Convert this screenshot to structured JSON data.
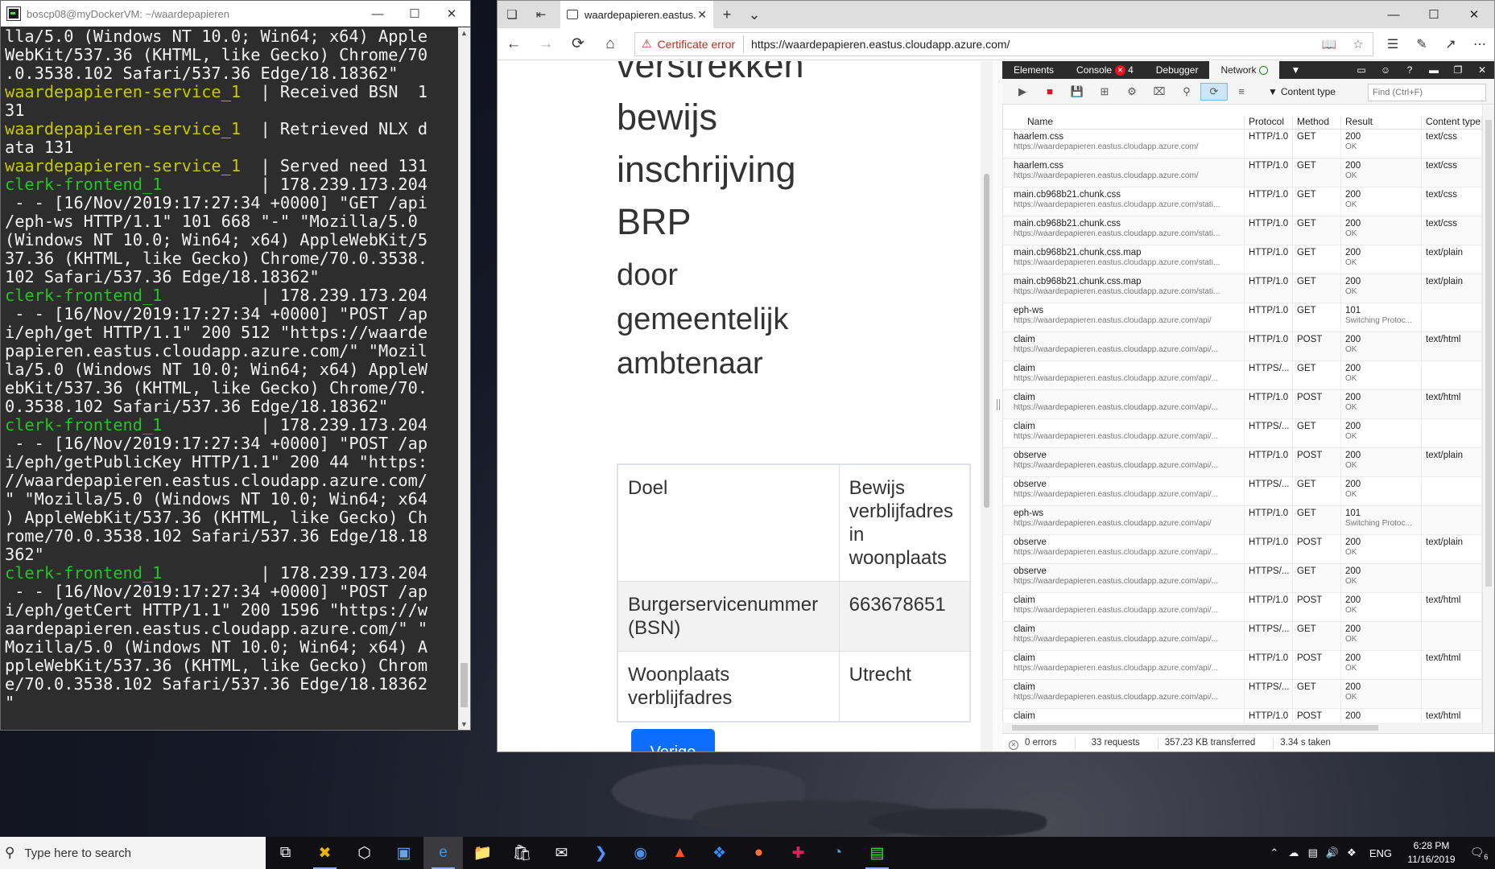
{
  "terminal": {
    "title": "boscp08@myDockerVM: ~/waardepapieren",
    "lines": [
      {
        "text": "lla/5.0 (Windows NT 10.0; Win64; x64) Apple"
      },
      {
        "text": "WebKit/537.36 (KHTML, like Gecko) Chrome/70"
      },
      {
        "text": ".0.3538.102 Safari/537.36 Edge/18.18362\""
      },
      {
        "prefix": "waardepapieren-service_1",
        "text": "  | Received BSN  1"
      },
      {
        "text": "31"
      },
      {
        "prefix": "waardepapieren-service_1",
        "text": "  | Retrieved NLX d"
      },
      {
        "text": "ata 131"
      },
      {
        "prefix": "waardepapieren-service_1",
        "text": "  | Served need 131"
      },
      {
        "prefix2": "clerk-frontend_1",
        "text": "          | 178.239.173.204"
      },
      {
        "text": " - - [16/Nov/2019:17:27:34 +0000] \"GET /api"
      },
      {
        "text": "/eph-ws HTTP/1.1\" 101 668 \"-\" \"Mozilla/5.0 "
      },
      {
        "text": "(Windows NT 10.0; Win64; x64) AppleWebKit/5"
      },
      {
        "text": "37.36 (KHTML, like Gecko) Chrome/70.0.3538."
      },
      {
        "text": "102 Safari/537.36 Edge/18.18362\""
      },
      {
        "prefix2": "clerk-frontend_1",
        "text": "          | 178.239.173.204"
      },
      {
        "text": " - - [16/Nov/2019:17:27:34 +0000] \"POST /ap"
      },
      {
        "text": "i/eph/get HTTP/1.1\" 200 512 \"https://waarde"
      },
      {
        "text": "papieren.eastus.cloudapp.azure.com/\" \"Mozil"
      },
      {
        "text": "la/5.0 (Windows NT 10.0; Win64; x64) AppleW"
      },
      {
        "text": "ebKit/537.36 (KHTML, like Gecko) Chrome/70."
      },
      {
        "text": "0.3538.102 Safari/537.36 Edge/18.18362\""
      },
      {
        "prefix2": "clerk-frontend_1",
        "text": "          | 178.239.173.204"
      },
      {
        "text": " - - [16/Nov/2019:17:27:34 +0000] \"POST /ap"
      },
      {
        "text": "i/eph/getPublicKey HTTP/1.1\" 200 44 \"https:"
      },
      {
        "text": "//waardepapieren.eastus.cloudapp.azure.com/"
      },
      {
        "text": "\" \"Mozilla/5.0 (Windows NT 10.0; Win64; x64"
      },
      {
        "text": ") AppleWebKit/537.36 (KHTML, like Gecko) Ch"
      },
      {
        "text": "rome/70.0.3538.102 Safari/537.36 Edge/18.18"
      },
      {
        "text": "362\""
      },
      {
        "prefix2": "clerk-frontend_1",
        "text": "          | 178.239.173.204"
      },
      {
        "text": " - - [16/Nov/2019:17:27:34 +0000] \"POST /ap"
      },
      {
        "text": "i/eph/getCert HTTP/1.1\" 200 1596 \"https://w"
      },
      {
        "text": "aardepapieren.eastus.cloudapp.azure.com/\" \""
      },
      {
        "text": "Mozilla/5.0 (Windows NT 10.0; Win64; x64) A"
      },
      {
        "text": "ppleWebKit/537.36 (KHTML, like Gecko) Chrom"
      },
      {
        "text": "e/70.0.3538.102 Safari/537.36 Edge/18.18362"
      },
      {
        "text": "\""
      }
    ]
  },
  "browser": {
    "tab_title": "waardepapieren.eastus.",
    "cert_error": "Certificate error",
    "url": "https://waardepapieren.eastus.cloudapp.azure.com/",
    "page": {
      "headings": [
        "verstrekken",
        "bewijs",
        "inschrijving",
        "BRP",
        "door",
        "gemeentelijk",
        "ambtenaar"
      ],
      "table": [
        [
          "Doel",
          "Bewijs verblijfadres in woonplaats"
        ],
        [
          "Burgerservicenummer (BSN)",
          "663678651"
        ],
        [
          "Woonplaats verblijfadres",
          "Utrecht"
        ]
      ],
      "button": "Vorige"
    }
  },
  "devtools": {
    "tabs": {
      "elements": "Elements",
      "console": "Console",
      "console_count": "4",
      "debugger": "Debugger",
      "network": "Network"
    },
    "content_type_filter": "Content type",
    "find_placeholder": "Find (Ctrl+F)",
    "columns": [
      "Name",
      "Protocol",
      "Method",
      "Result",
      "Content type"
    ],
    "requests": [
      {
        "name": "haarlem.css",
        "url": "https://waardepapieren.eastus.cloudapp.azure.com/",
        "protocol": "HTTP/1.0",
        "method": "GET",
        "status": "200",
        "status_text": "OK",
        "type": "text/css"
      },
      {
        "name": "haarlem.css",
        "url": "https://waardepapieren.eastus.cloudapp.azure.com/",
        "protocol": "HTTP/1.0",
        "method": "GET",
        "status": "200",
        "status_text": "OK",
        "type": "text/css"
      },
      {
        "name": "main.cb968b21.chunk.css",
        "url": "https://waardepapieren.eastus.cloudapp.azure.com/stati...",
        "protocol": "HTTP/1.0",
        "method": "GET",
        "status": "200",
        "status_text": "OK",
        "type": "text/css"
      },
      {
        "name": "main.cb968b21.chunk.css",
        "url": "https://waardepapieren.eastus.cloudapp.azure.com/stati...",
        "protocol": "HTTP/1.0",
        "method": "GET",
        "status": "200",
        "status_text": "OK",
        "type": "text/css"
      },
      {
        "name": "main.cb968b21.chunk.css.map",
        "url": "https://waardepapieren.eastus.cloudapp.azure.com/stati...",
        "protocol": "HTTP/1.0",
        "method": "GET",
        "status": "200",
        "status_text": "OK",
        "type": "text/plain"
      },
      {
        "name": "main.cb968b21.chunk.css.map",
        "url": "https://waardepapieren.eastus.cloudapp.azure.com/stati...",
        "protocol": "HTTP/1.0",
        "method": "GET",
        "status": "200",
        "status_text": "OK",
        "type": "text/plain"
      },
      {
        "name": "eph-ws",
        "url": "https://waardepapieren.eastus.cloudapp.azure.com/api/",
        "protocol": "HTTP/1.0",
        "method": "GET",
        "status": "101",
        "status_text": "Switching Protoc...",
        "type": ""
      },
      {
        "name": "claim",
        "url": "https://waardepapieren.eastus.cloudapp.azure.com/api/...",
        "protocol": "HTTP/1.0",
        "method": "POST",
        "status": "200",
        "status_text": "OK",
        "type": "text/html"
      },
      {
        "name": "claim",
        "url": "https://waardepapieren.eastus.cloudapp.azure.com/api/...",
        "protocol": "HTTPS/...",
        "method": "GET",
        "status": "200",
        "status_text": "OK",
        "type": ""
      },
      {
        "name": "claim",
        "url": "https://waardepapieren.eastus.cloudapp.azure.com/api/...",
        "protocol": "HTTP/1.0",
        "method": "POST",
        "status": "200",
        "status_text": "OK",
        "type": "text/html"
      },
      {
        "name": "claim",
        "url": "https://waardepapieren.eastus.cloudapp.azure.com/api/...",
        "protocol": "HTTPS/...",
        "method": "GET",
        "status": "200",
        "status_text": "OK",
        "type": ""
      },
      {
        "name": "observe",
        "url": "https://waardepapieren.eastus.cloudapp.azure.com/api/...",
        "protocol": "HTTP/1.0",
        "method": "POST",
        "status": "200",
        "status_text": "OK",
        "type": "text/plain"
      },
      {
        "name": "observe",
        "url": "https://waardepapieren.eastus.cloudapp.azure.com/api/...",
        "protocol": "HTTPS/...",
        "method": "GET",
        "status": "200",
        "status_text": "OK",
        "type": ""
      },
      {
        "name": "eph-ws",
        "url": "https://waardepapieren.eastus.cloudapp.azure.com/api/",
        "protocol": "HTTP/1.0",
        "method": "GET",
        "status": "101",
        "status_text": "Switching Protoc...",
        "type": ""
      },
      {
        "name": "observe",
        "url": "https://waardepapieren.eastus.cloudapp.azure.com/api/...",
        "protocol": "HTTP/1.0",
        "method": "POST",
        "status": "200",
        "status_text": "OK",
        "type": "text/plain"
      },
      {
        "name": "observe",
        "url": "https://waardepapieren.eastus.cloudapp.azure.com/api/...",
        "protocol": "HTTPS/...",
        "method": "GET",
        "status": "200",
        "status_text": "OK",
        "type": ""
      },
      {
        "name": "claim",
        "url": "https://waardepapieren.eastus.cloudapp.azure.com/api/...",
        "protocol": "HTTP/1.0",
        "method": "POST",
        "status": "200",
        "status_text": "OK",
        "type": "text/html"
      },
      {
        "name": "claim",
        "url": "https://waardepapieren.eastus.cloudapp.azure.com/api/...",
        "protocol": "HTTPS/...",
        "method": "GET",
        "status": "200",
        "status_text": "OK",
        "type": ""
      },
      {
        "name": "claim",
        "url": "https://waardepapieren.eastus.cloudapp.azure.com/api/...",
        "protocol": "HTTP/1.0",
        "method": "POST",
        "status": "200",
        "status_text": "OK",
        "type": "text/html"
      },
      {
        "name": "claim",
        "url": "https://waardepapieren.eastus.cloudapp.azure.com/api/...",
        "protocol": "HTTPS/...",
        "method": "GET",
        "status": "200",
        "status_text": "OK",
        "type": ""
      },
      {
        "name": "claim",
        "url": "",
        "protocol": "HTTP/1.0",
        "method": "POST",
        "status": "200",
        "status_text": "",
        "type": "text/html"
      }
    ],
    "status": {
      "errors": "0 errors",
      "requests": "33 requests",
      "transferred": "357.23 KB transferred",
      "taken": "3.34 s taken"
    }
  },
  "taskbar": {
    "search_placeholder": "Type here to search",
    "language": "ENG",
    "time": "6:28 PM",
    "date": "11/16/2019",
    "notifications": "6"
  }
}
